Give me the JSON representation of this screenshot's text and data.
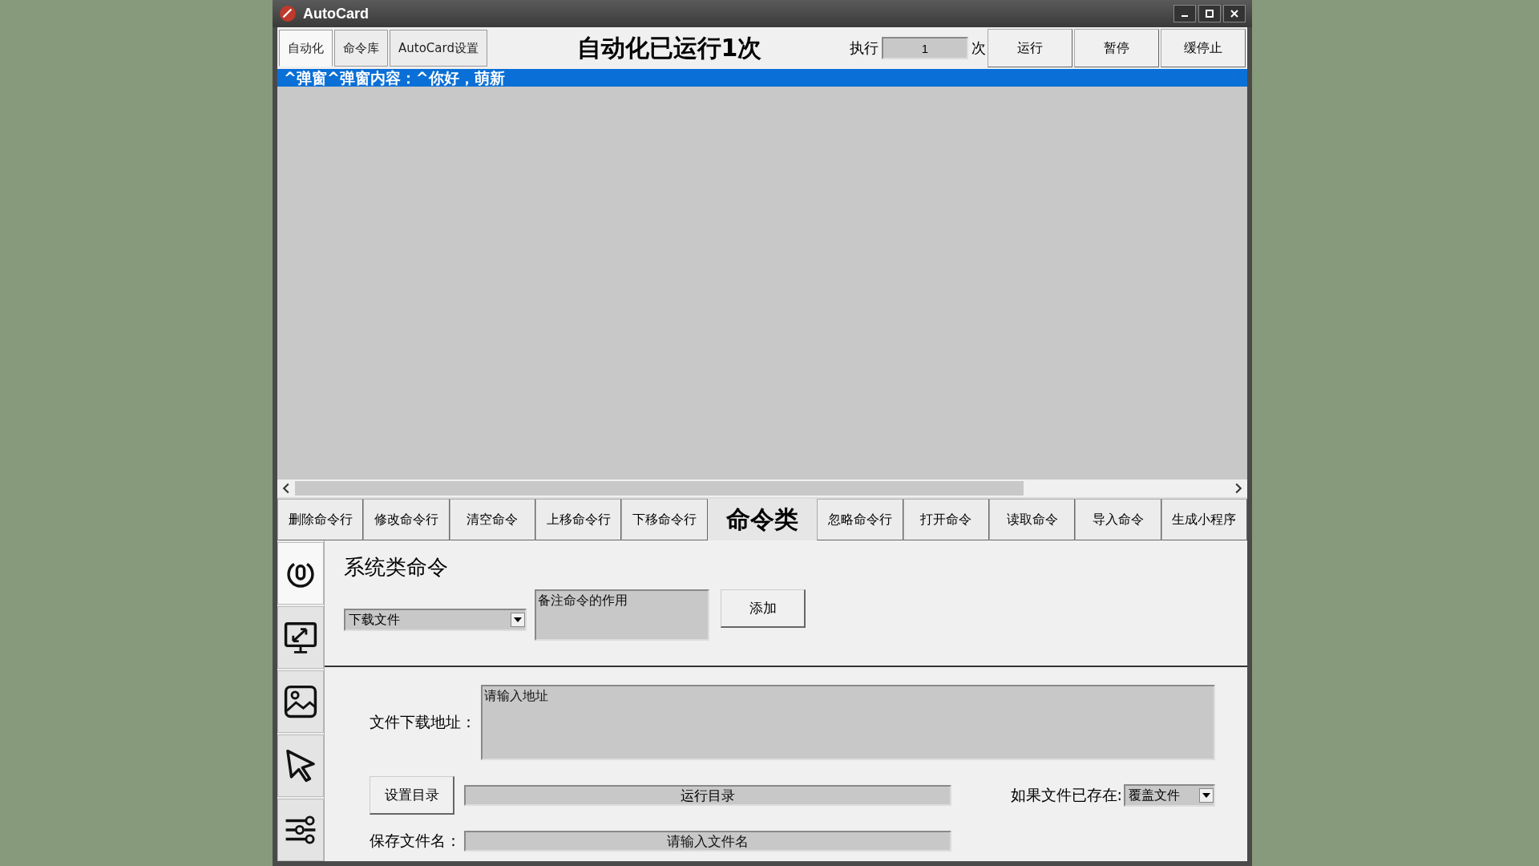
{
  "window": {
    "title": "AutoCard"
  },
  "tabs": [
    {
      "label": "自动化",
      "selected": true
    },
    {
      "label": "命令库",
      "selected": false
    },
    {
      "label": "AutoCard设置",
      "selected": false
    }
  ],
  "run_status": "自动化已运行1次",
  "execute": {
    "label": "执行",
    "value": "1",
    "unit": "次"
  },
  "run_buttons": [
    "运行",
    "暂停",
    "缓停止"
  ],
  "command_list": [
    {
      "text": "^弹窗^弹窗内容：^你好，萌新",
      "selected": true
    }
  ],
  "command_toolbar": [
    {
      "kind": "button",
      "label": "删除命令行"
    },
    {
      "kind": "button",
      "label": "修改命令行"
    },
    {
      "kind": "button",
      "label": "清空命令"
    },
    {
      "kind": "button",
      "label": "上移命令行"
    },
    {
      "kind": "button",
      "label": "下移命令行"
    },
    {
      "kind": "heading",
      "label": "命令类"
    },
    {
      "kind": "button",
      "label": "忽略命令行"
    },
    {
      "kind": "button",
      "label": "打开命令"
    },
    {
      "kind": "button",
      "label": "读取命令"
    },
    {
      "kind": "button",
      "label": "导入命令"
    },
    {
      "kind": "button",
      "label": "生成小程序"
    }
  ],
  "category_tabs": [
    {
      "kind": "power",
      "selected": true
    },
    {
      "kind": "monitor",
      "selected": false
    },
    {
      "kind": "image",
      "selected": false
    },
    {
      "kind": "cursor",
      "selected": false
    },
    {
      "kind": "sliders",
      "selected": false
    }
  ],
  "panel": {
    "title": "系统类命令",
    "command_select": "下载文件",
    "note": {
      "placeholder": "备注命令的作用"
    },
    "add_button": "添加"
  },
  "form": {
    "url_label": "文件下载地址：",
    "url": {
      "placeholder": "请输入地址"
    },
    "dir_button": "设置目录",
    "dir_value": "运行目录",
    "exists_label": "如果文件已存在:",
    "exists_select": "覆盖文件",
    "name_label": "保存文件名：",
    "name": {
      "placeholder": "请输入文件名"
    }
  }
}
